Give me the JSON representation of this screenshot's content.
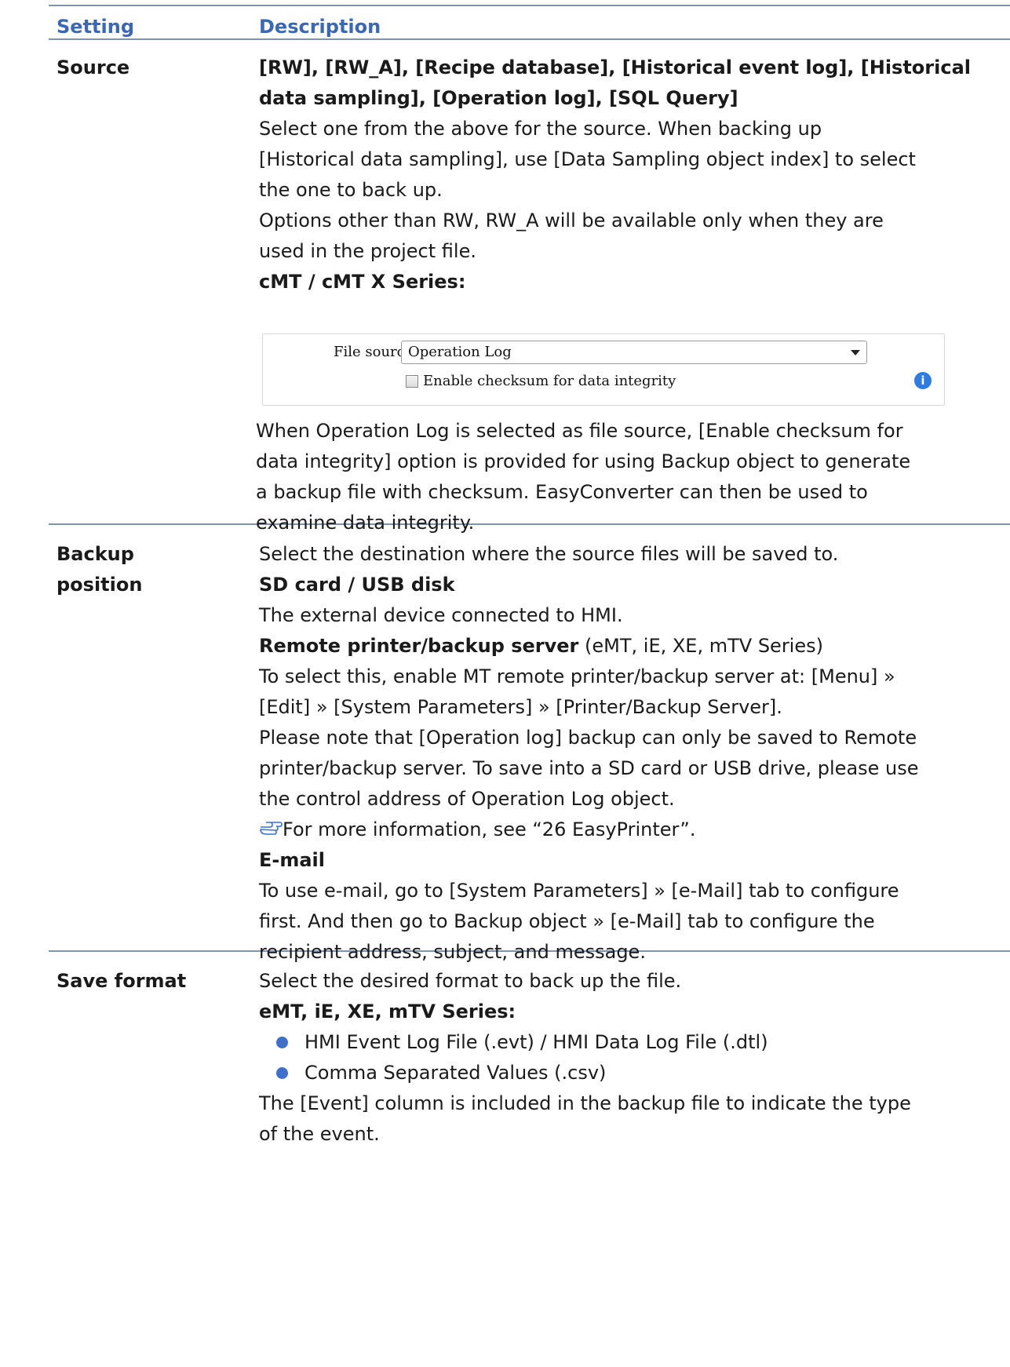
{
  "header": {
    "setting": "Setting",
    "description": "Description"
  },
  "rows": {
    "source": {
      "label": "Source",
      "bold_line1": "[RW], [RW_A], [Recipe database], [Historical event log], [Historical",
      "bold_line2": "data sampling], [Operation log], [SQL Query]",
      "p1_l1": "Select one from the above for the source. When backing up",
      "p1_l2": "[Historical data sampling], use [Data Sampling object index] to select",
      "p1_l3": "the one to back up.",
      "p2_l1": "Options other than RW, RW_A will be available only when they are",
      "p2_l2": "used in the project file.",
      "series_heading": "cMT / cMT X Series:",
      "dialog": {
        "file_source_label": "File source :",
        "file_source_value": "Operation Log",
        "checkbox_label": "Enable checksum for data integrity",
        "checkbox_checked": false,
        "info_icon": "info-icon"
      },
      "p3_l1": "When Operation Log is selected as file source, [Enable checksum for",
      "p3_l2": "data integrity] option is provided for using Backup object to generate",
      "p3_l3": "a backup file with checksum. EasyConverter can then be used to",
      "p3_l4": "examine data integrity."
    },
    "backup_position": {
      "label_l1": "Backup",
      "label_l2": "position",
      "intro": "Select the destination where the source files will be saved to.",
      "sd_heading": "SD card / USB disk",
      "sd_text": "The external device connected to HMI.",
      "remote_heading": "Remote printer/backup server",
      "remote_suffix": " (eMT, iE, XE, mTV Series)",
      "remote_l1": "To select this, enable MT remote printer/backup server at: [Menu] »",
      "remote_l2": "[Edit] » [System Parameters] » [Printer/Backup Server].",
      "note_l1": "Please note that [Operation log] backup can only be saved to Remote",
      "note_l2": "printer/backup server. To save into a SD card or USB drive, please use",
      "note_l3": "the control address of Operation Log object.",
      "ref_icon": "pointing-hand-icon",
      "ref_text": "For more information, see “26 EasyPrinter”.",
      "email_heading": "E-mail",
      "email_l1": "To use e-mail, go to [System Parameters] » [e-Mail] tab to configure",
      "email_l2": "first. And then go to Backup object » [e-Mail] tab to configure the",
      "email_l3": "recipient address, subject, and message."
    },
    "save_format": {
      "label": "Save format",
      "intro": "Select the desired format to back up the file.",
      "series_heading": "eMT, iE, XE, mTV Series:",
      "bullets": [
        "HMI Event Log File (.evt) / HMI Data Log File (.dtl)",
        "Comma Separated Values (.csv)"
      ],
      "tail_l1": "The [Event] column is included in the backup file to indicate the type",
      "tail_l2": "of the event."
    }
  },
  "colors": {
    "header_text": "#3a68b3",
    "rule": "#7f92b4",
    "bullet": "#3f6fc6",
    "info_icon": "#2f7be0"
  }
}
